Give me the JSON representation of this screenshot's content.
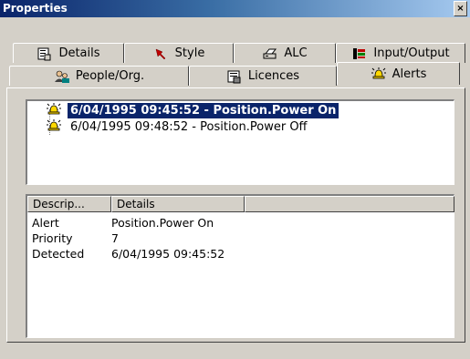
{
  "window": {
    "title": "Properties",
    "close_glyph": "×"
  },
  "tabs_row1": [
    {
      "label": "Details",
      "icon": "document-properties-icon"
    },
    {
      "label": "Style",
      "icon": "pin-icon"
    },
    {
      "label": "ALC",
      "icon": "printer-icon"
    },
    {
      "label": "Input/Output",
      "icon": "input-output-icon"
    }
  ],
  "tabs_row2": [
    {
      "label": "People/Org.",
      "icon": "people-icon"
    },
    {
      "label": "Licences",
      "icon": "licence-icon"
    },
    {
      "label": "Alerts",
      "icon": "alert-bell-icon",
      "active": true
    }
  ],
  "alerts_tree": [
    {
      "label": "6/04/1995 09:45:52 - Position.Power On",
      "selected": true
    },
    {
      "label": "6/04/1995 09:48:52 - Position.Power Off",
      "selected": false
    }
  ],
  "details_list": {
    "columns": [
      "Descrip...",
      "Details"
    ],
    "rows": [
      {
        "name": "Alert",
        "value": "Position.Power On"
      },
      {
        "name": "Priority",
        "value": "7"
      },
      {
        "name": "Detected",
        "value": "6/04/1995 09:45:52"
      }
    ]
  },
  "colors": {
    "titlebar_start": "#0a246a",
    "titlebar_end": "#a6caf0",
    "selection": "#0a246a",
    "face": "#d4d0c8"
  }
}
